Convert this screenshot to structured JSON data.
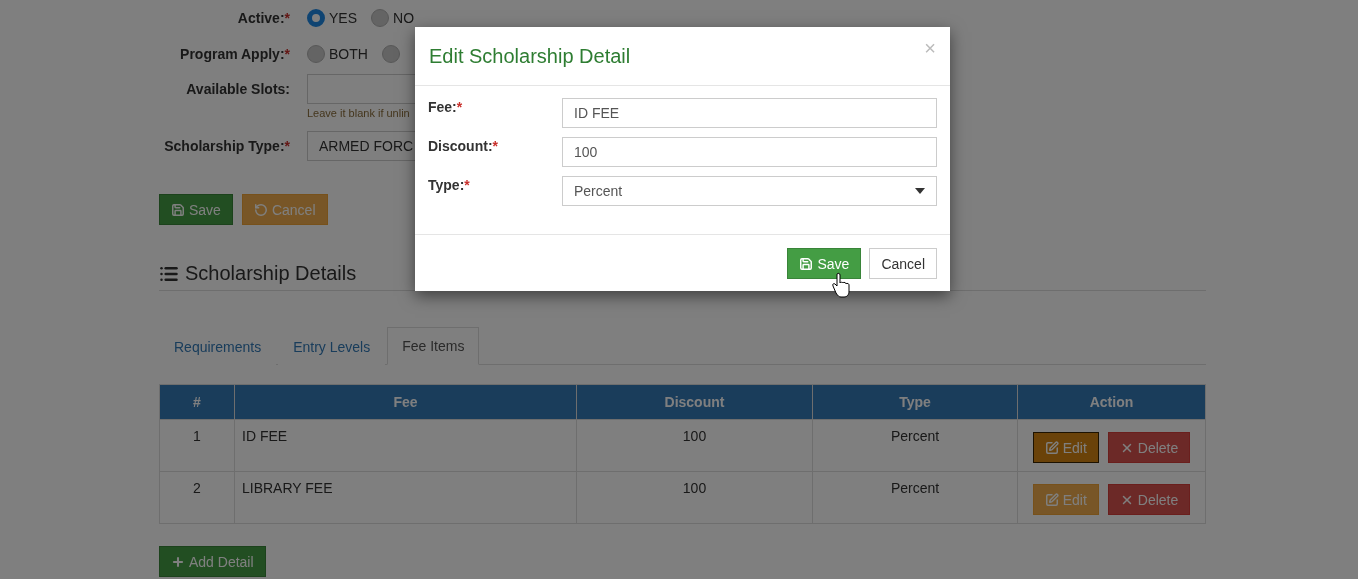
{
  "form": {
    "fields": [
      {
        "kind": "radio",
        "label": "Active:",
        "required": "*",
        "options": [
          {
            "label": "YES",
            "selected": true
          },
          {
            "label": "NO",
            "selected": false
          }
        ]
      },
      {
        "kind": "radio",
        "label": "Program Apply:",
        "required": "*",
        "options": [
          {
            "label": "BOTH",
            "selected": false
          },
          {
            "selected": false
          }
        ]
      },
      {
        "kind": "text",
        "label": "Available Slots:",
        "help": "Leave it blank if unlin"
      },
      {
        "kind": "select",
        "label": "Scholarship Type:",
        "required": "*",
        "value": "ARMED FORC"
      }
    ],
    "buttons": [
      {
        "kind": "save",
        "label": "Save"
      },
      {
        "kind": "cancel",
        "label": "Cancel"
      }
    ]
  },
  "section": {
    "title": "Scholarship Details",
    "tabs": [
      {
        "label": "Requirements",
        "selected": false
      },
      {
        "label": "Entry Levels",
        "selected": false
      },
      {
        "label": "Fee Items",
        "selected": true
      }
    ],
    "table": {
      "columns": [
        "#",
        "Fee",
        "Discount",
        "Type",
        "Action"
      ],
      "rows": [
        {
          "cells": [
            "1",
            "ID FEE",
            "100",
            "Percent"
          ],
          "actions": [
            {
              "kind": "edit",
              "label": "Edit",
              "active": true
            },
            {
              "kind": "delete",
              "label": "Delete"
            }
          ]
        },
        {
          "cells": [
            "2",
            "LIBRARY FEE",
            "100",
            "Percent"
          ],
          "actions": [
            {
              "kind": "edit",
              "label": "Edit",
              "active": false
            },
            {
              "kind": "delete",
              "label": "Delete"
            }
          ]
        }
      ]
    },
    "add_button": "Add Detail"
  },
  "modal": {
    "title": "Edit Scholarship Detail",
    "close": "×",
    "fields": [
      {
        "kind": "text",
        "label": "Fee:",
        "required": "*",
        "value": "ID FEE"
      },
      {
        "kind": "text",
        "label": "Discount:",
        "required": "*",
        "value": "100"
      },
      {
        "kind": "select",
        "label": "Type:",
        "required": "*",
        "value": "Percent"
      }
    ],
    "buttons": [
      {
        "kind": "save",
        "label": "Save"
      },
      {
        "kind": "cancel",
        "label": "Cancel"
      }
    ]
  }
}
